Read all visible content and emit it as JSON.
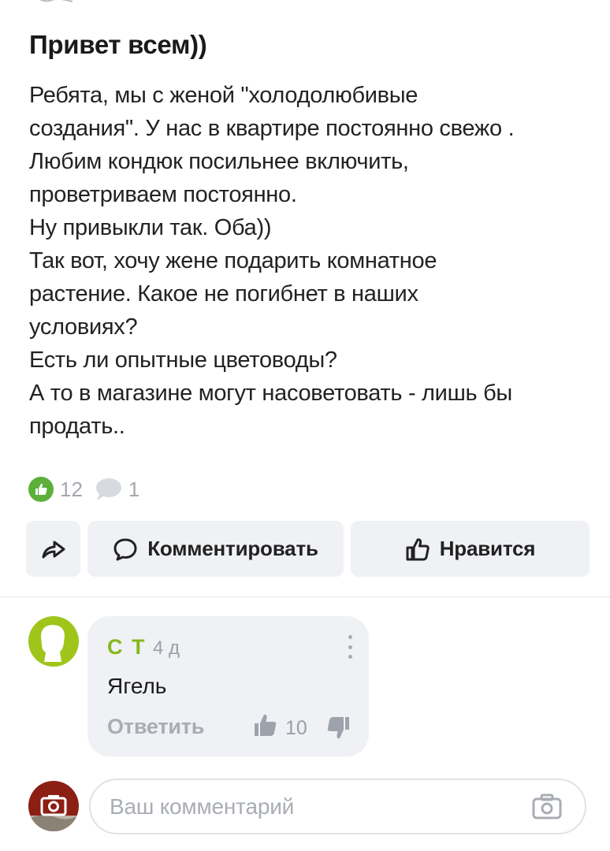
{
  "post": {
    "title": "Привет всем))",
    "body_lines": [
      "Ребята, мы с женой \"холодолюбивые",
      "создания\". У нас в квартире постоянно свежо .",
      "Любим кондюк посильнее включить,",
      "проветриваем постоянно.",
      "Ну привыкли так. Оба))",
      "Так вот, хочу жене подарить комнатное",
      "растение. Какое не погибнет в наших",
      "условиях?",
      "Есть ли опытные цветоводы?",
      "А то в магазине могут насоветовать - лишь бы",
      "продать.."
    ],
    "likes_count": "12",
    "comments_count": "1"
  },
  "actions": {
    "share_icon": "share-arrow-icon",
    "comment_label": "Комментировать",
    "like_label": "Нравится"
  },
  "comment": {
    "author": "С Т",
    "time": "4 д",
    "text": "Ягель",
    "reply_label": "Ответить",
    "likes": "10",
    "author_color": "#86b81a"
  },
  "composer": {
    "placeholder": "Ваш комментарий",
    "camera_icon": "camera-icon"
  },
  "colors": {
    "accent_green": "#5cb03a",
    "avatar_green": "#9fc51b",
    "user_avatar": "#8c1f14",
    "button_bg": "#eff1f4"
  }
}
